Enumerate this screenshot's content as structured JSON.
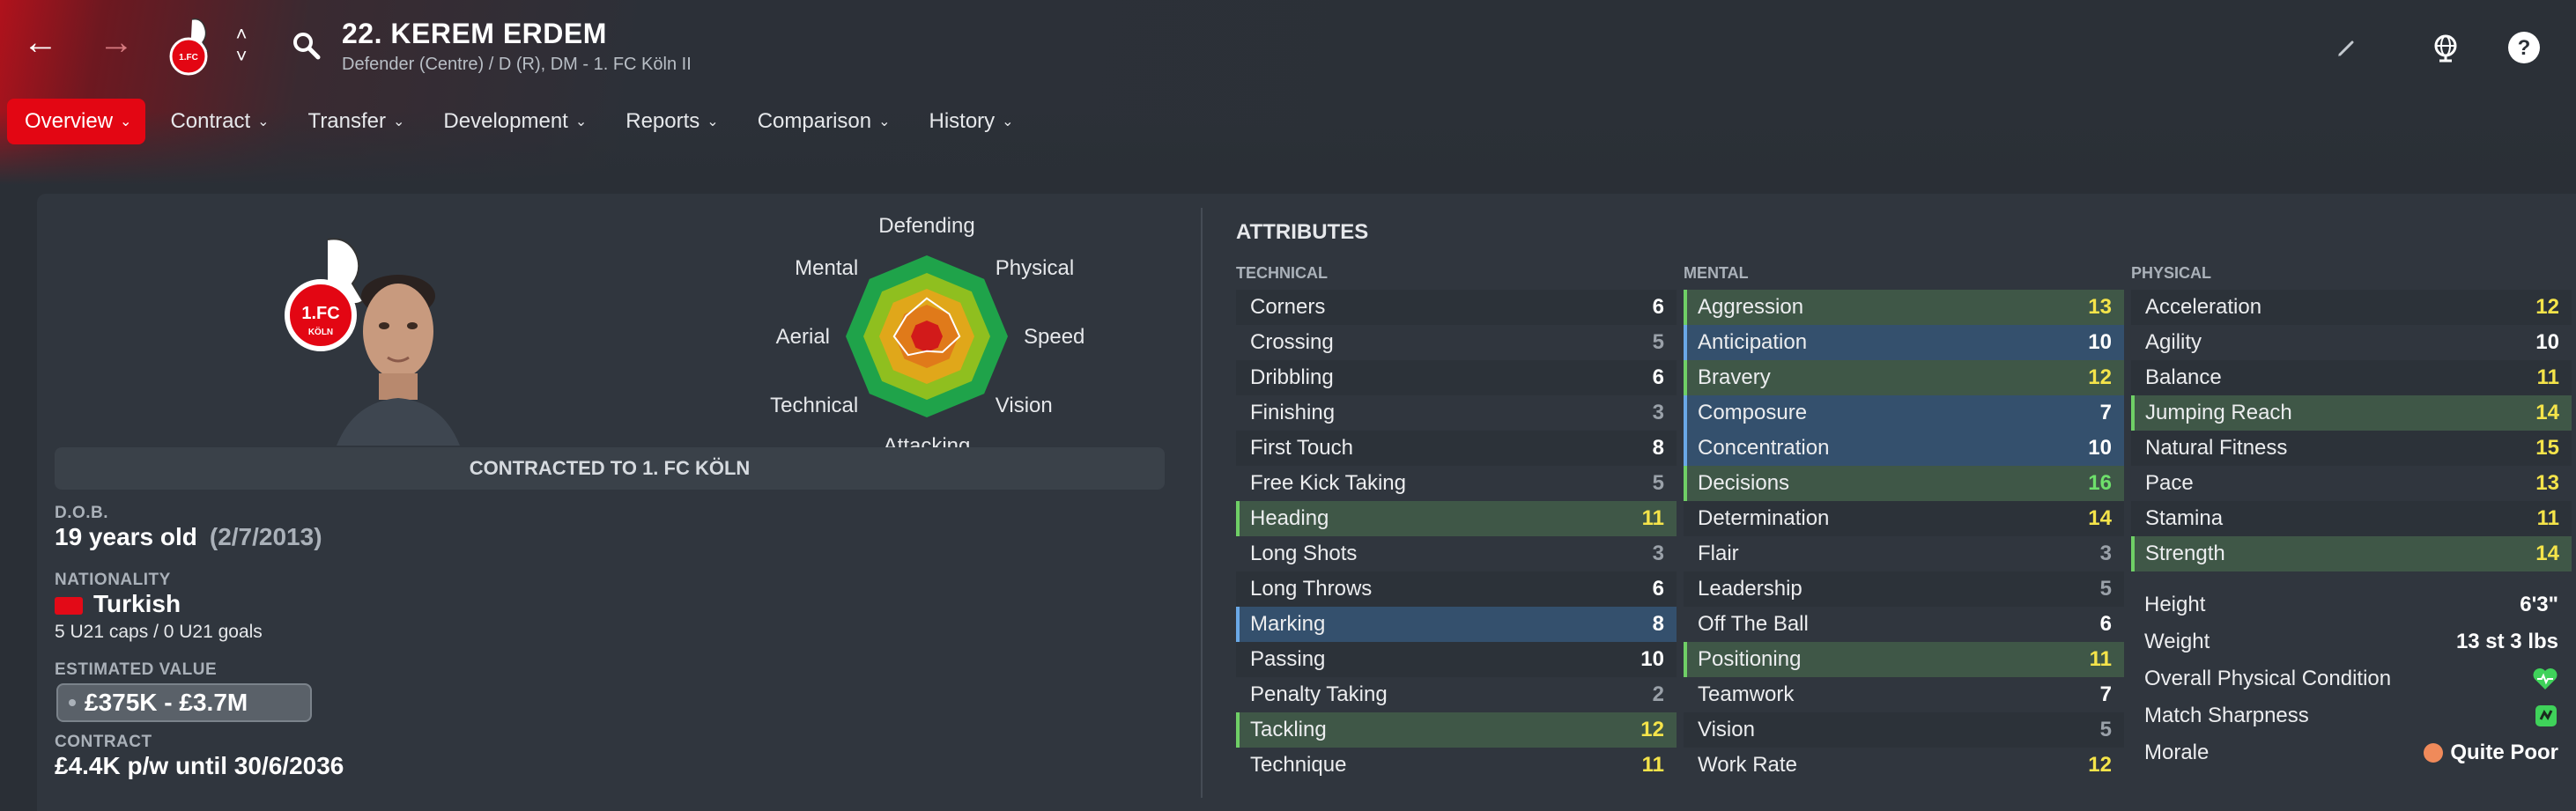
{
  "header": {
    "player_name": "22. KEREM ERDEM",
    "player_sub": "Defender (Centre) / D (R), DM - 1. FC Köln II",
    "badge_text": "1.FC KÖLN"
  },
  "tabs": [
    {
      "label": "Overview",
      "active": true
    },
    {
      "label": "Contract",
      "active": false
    },
    {
      "label": "Transfer",
      "active": false
    },
    {
      "label": "Development",
      "active": false
    },
    {
      "label": "Reports",
      "active": false
    },
    {
      "label": "Comparison",
      "active": false
    },
    {
      "label": "History",
      "active": false
    }
  ],
  "radar": {
    "labels": [
      "Defending",
      "Physical",
      "Speed",
      "Vision",
      "Attacking",
      "Technical",
      "Aerial",
      "Mental"
    ]
  },
  "contract_banner": "CONTRACTED TO 1. FC KÖLN",
  "info": {
    "dob_label": "D.O.B.",
    "dob_age": "19 years old",
    "dob_date": "(2/7/2013)",
    "nationality_label": "NATIONALITY",
    "nationality": "Turkish",
    "caps": "5 U21 caps / 0 U21 goals",
    "value_label": "ESTIMATED VALUE",
    "value": "£375K - £3.7M",
    "contract_label": "CONTRACT",
    "contract": "£4.4K p/w until 30/6/2036"
  },
  "attributes": {
    "title": "ATTRIBUTES",
    "technical_head": "TECHNICAL",
    "mental_head": "MENTAL",
    "physical_head": "PHYSICAL",
    "technical": [
      {
        "name": "Corners",
        "value": "6",
        "hl": ""
      },
      {
        "name": "Crossing",
        "value": "5",
        "hl": ""
      },
      {
        "name": "Dribbling",
        "value": "6",
        "hl": ""
      },
      {
        "name": "Finishing",
        "value": "3",
        "hl": ""
      },
      {
        "name": "First Touch",
        "value": "8",
        "hl": ""
      },
      {
        "name": "Free Kick Taking",
        "value": "5",
        "hl": ""
      },
      {
        "name": "Heading",
        "value": "11",
        "hl": "green"
      },
      {
        "name": "Long Shots",
        "value": "3",
        "hl": ""
      },
      {
        "name": "Long Throws",
        "value": "6",
        "hl": ""
      },
      {
        "name": "Marking",
        "value": "8",
        "hl": "blue"
      },
      {
        "name": "Passing",
        "value": "10",
        "hl": ""
      },
      {
        "name": "Penalty Taking",
        "value": "2",
        "hl": ""
      },
      {
        "name": "Tackling",
        "value": "12",
        "hl": "green"
      },
      {
        "name": "Technique",
        "value": "11",
        "hl": ""
      }
    ],
    "mental": [
      {
        "name": "Aggression",
        "value": "13",
        "hl": "green"
      },
      {
        "name": "Anticipation",
        "value": "10",
        "hl": "blue"
      },
      {
        "name": "Bravery",
        "value": "12",
        "hl": "green"
      },
      {
        "name": "Composure",
        "value": "7",
        "hl": "blue"
      },
      {
        "name": "Concentration",
        "value": "10",
        "hl": "blue"
      },
      {
        "name": "Decisions",
        "value": "16",
        "hl": "green"
      },
      {
        "name": "Determination",
        "value": "14",
        "hl": ""
      },
      {
        "name": "Flair",
        "value": "3",
        "hl": ""
      },
      {
        "name": "Leadership",
        "value": "5",
        "hl": ""
      },
      {
        "name": "Off The Ball",
        "value": "6",
        "hl": ""
      },
      {
        "name": "Positioning",
        "value": "11",
        "hl": "green"
      },
      {
        "name": "Teamwork",
        "value": "7",
        "hl": ""
      },
      {
        "name": "Vision",
        "value": "5",
        "hl": ""
      },
      {
        "name": "Work Rate",
        "value": "12",
        "hl": ""
      }
    ],
    "physical": [
      {
        "name": "Acceleration",
        "value": "12",
        "hl": ""
      },
      {
        "name": "Agility",
        "value": "10",
        "hl": ""
      },
      {
        "name": "Balance",
        "value": "11",
        "hl": ""
      },
      {
        "name": "Jumping Reach",
        "value": "14",
        "hl": "green"
      },
      {
        "name": "Natural Fitness",
        "value": "15",
        "hl": ""
      },
      {
        "name": "Pace",
        "value": "13",
        "hl": ""
      },
      {
        "name": "Stamina",
        "value": "11",
        "hl": ""
      },
      {
        "name": "Strength",
        "value": "14",
        "hl": "green"
      }
    ]
  },
  "physical_info": {
    "height_label": "Height",
    "height": "6'3\"",
    "weight_label": "Weight",
    "weight": "13 st 3 lbs",
    "condition_label": "Overall Physical Condition",
    "sharpness_label": "Match Sharpness",
    "morale_label": "Morale",
    "morale": "Quite Poor"
  },
  "colors": {
    "accent": "#e30613",
    "v_low": "#9aa1a9",
    "v_mid": "#ffffff",
    "v_good": "#f5e44a",
    "v_high": "#6ee06b"
  }
}
